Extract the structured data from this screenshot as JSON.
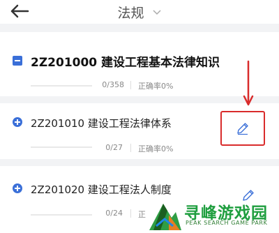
{
  "header": {
    "title": "法规",
    "back_icon": "arrow-left-icon",
    "dropdown_icon": "chevron-down-icon"
  },
  "chapters": [
    {
      "code_title": "2Z201000 建设工程基本法律知识",
      "count": "0/358",
      "accuracy": "正确率0%",
      "expanded": true,
      "progress": 0
    },
    {
      "code_title": "2Z201010 建设工程法律体系",
      "count": "0/27",
      "accuracy": "正确率0%",
      "progress": 0
    },
    {
      "code_title": "2Z201020 建设工程法人制度",
      "count": "0/24",
      "accuracy": "正",
      "progress": 0
    }
  ],
  "watermark": {
    "title": "寻峰游戏园",
    "subtitle": "PEAK SEARCH GAME PARK"
  },
  "colors": {
    "accent": "#3a6fd8",
    "highlight": "#d92b2b",
    "watermark": "#1f9e3f"
  }
}
